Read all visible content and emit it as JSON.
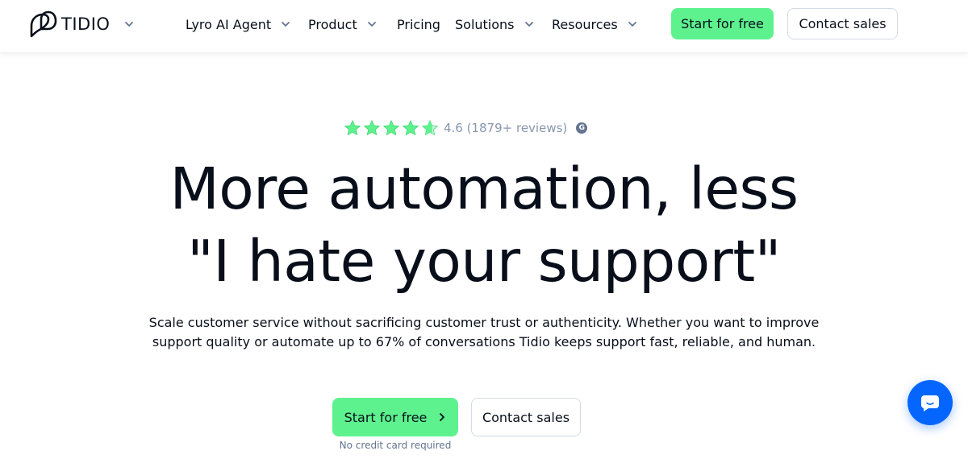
{
  "brand": {
    "name": "TIDIO",
    "logo_icon": "tidio-logo-icon",
    "accent_green": "#5df28e",
    "text_dark": "#080f1a",
    "chat_blue": "#0566ff"
  },
  "nav": {
    "items": [
      {
        "label": "Lyro AI Agent",
        "has_dropdown": true
      },
      {
        "label": "Product",
        "has_dropdown": true
      },
      {
        "label": "Pricing",
        "has_dropdown": false
      },
      {
        "label": "Solutions",
        "has_dropdown": true
      },
      {
        "label": "Resources",
        "has_dropdown": true
      }
    ],
    "start_label": "Start for free",
    "contact_label": "Contact sales"
  },
  "hero": {
    "rating": {
      "stars": 4.6,
      "text": "4.6 (1879+ reviews)",
      "badge": "G",
      "star_color": "#5df28e"
    },
    "headline_line1": "More automation, less",
    "headline_line2": "\"I hate your support\"",
    "subtext": "Scale customer service without sacrificing customer trust or authenticity. Whether you want to improve support quality or automate up to 67% of conversations Tidio keeps support fast, reliable, and human.",
    "cta_primary": "Start for free",
    "cta_secondary": "Contact sales",
    "note": "No credit card required"
  },
  "chat_widget": {
    "icon": "chat-bubble-icon"
  }
}
